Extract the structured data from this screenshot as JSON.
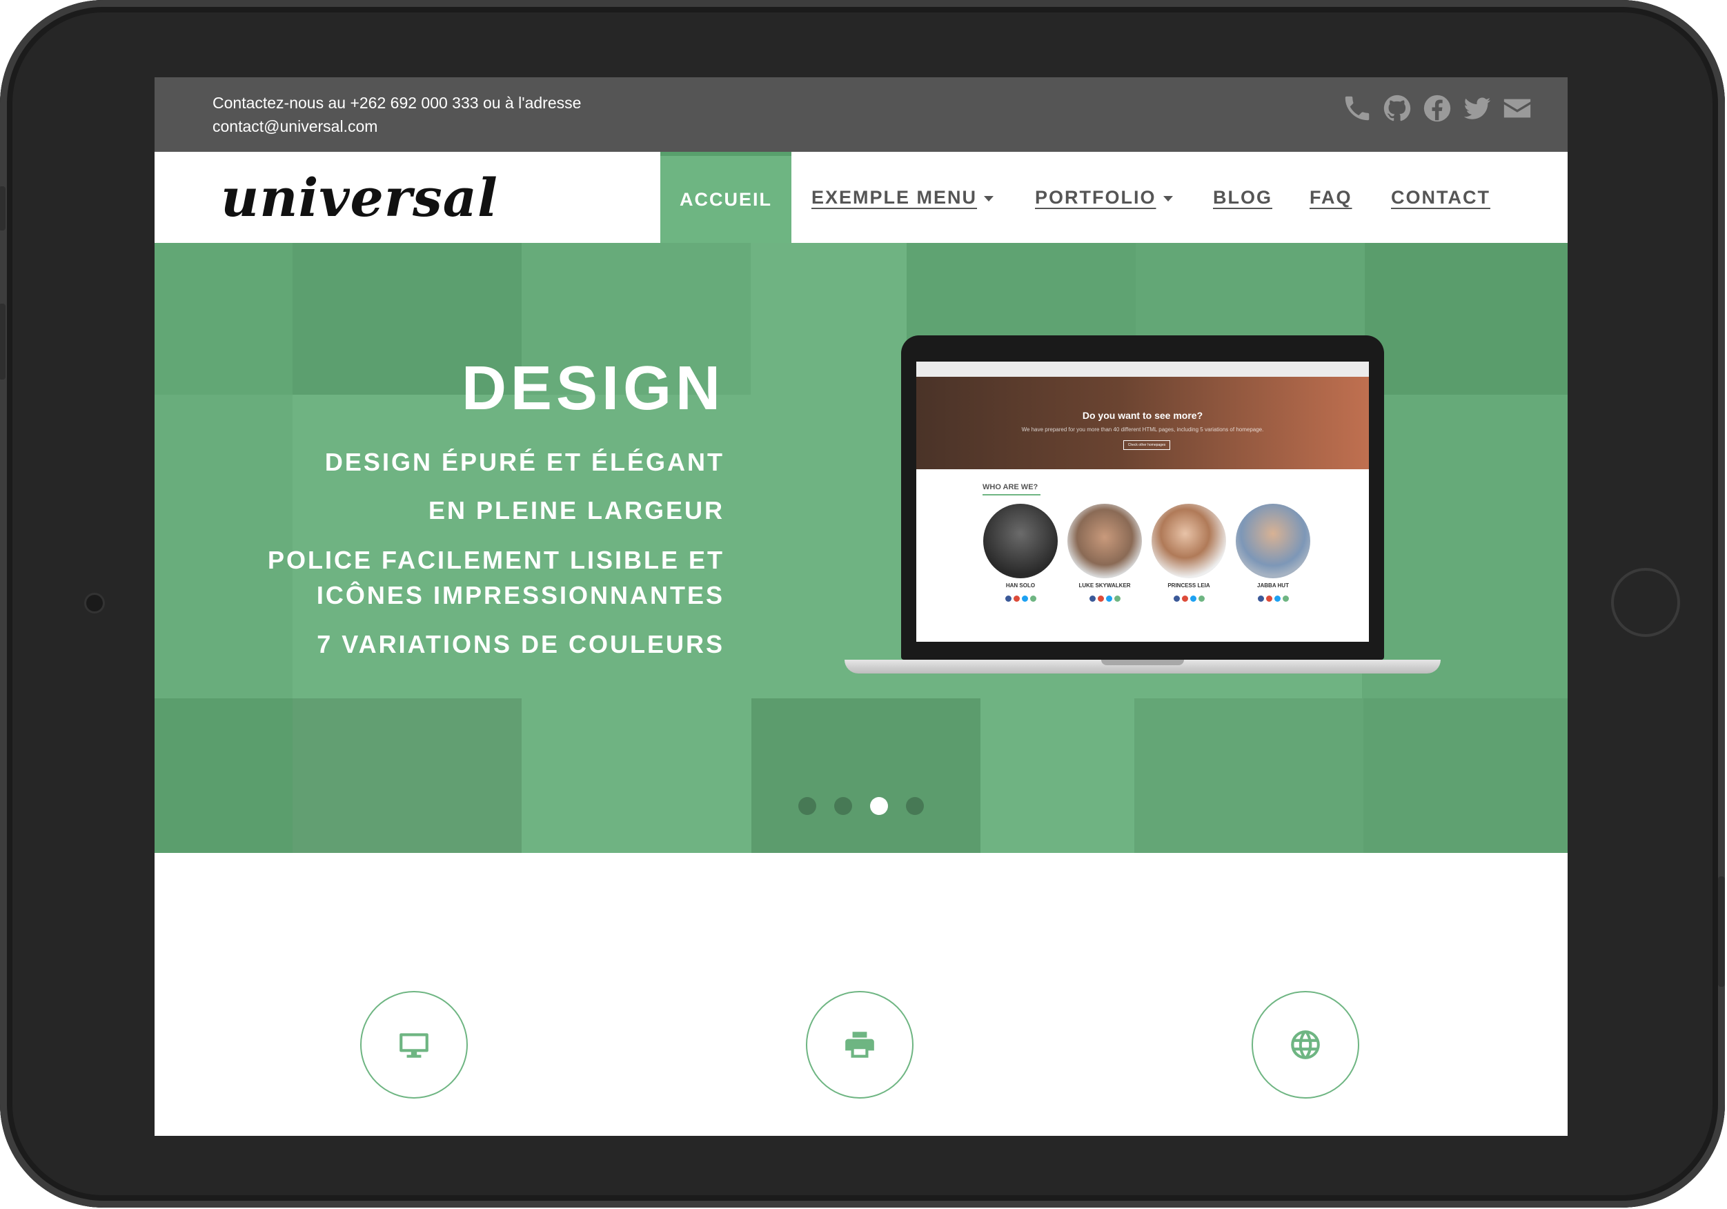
{
  "topbar": {
    "contact_line1": "Contactez-nous au +262 692 000 333 ou à l'adresse",
    "contact_line2": "contact@universal.com",
    "social_icons": [
      "phone-icon",
      "github-icon",
      "facebook-icon",
      "twitter-icon",
      "envelope-icon"
    ]
  },
  "navbar": {
    "logo": "universal",
    "items": [
      {
        "label": "ACCUEIL",
        "active": true
      },
      {
        "label": "EXEMPLE MENU",
        "dropdown": true
      },
      {
        "label": "PORTFOLIO",
        "dropdown": true
      },
      {
        "label": "BLOG"
      },
      {
        "label": "FAQ"
      },
      {
        "label": "CONTACT"
      }
    ]
  },
  "hero": {
    "title": "DESIGN",
    "lines": [
      "DESIGN ÉPURÉ ET ÉLÉGANT",
      "EN PLEINE LARGEUR",
      "POLICE FACILEMENT LISIBLE ET",
      "ICÔNES IMPRESSIONNANTES",
      "7 VARIATIONS DE COULEURS"
    ],
    "laptop_screen": {
      "hero_title": "Do you want to see more?",
      "hero_subtitle": "We have prepared for you more than 40 different HTML pages, including 5 variations of homepage.",
      "hero_button": "Check other homepages",
      "section_title": "WHO ARE WE?",
      "people": [
        {
          "name": "HAN SOLO"
        },
        {
          "name": "LUKE SKYWALKER"
        },
        {
          "name": "PRINCESS LEIA"
        },
        {
          "name": "JABBA HUT"
        }
      ]
    },
    "carousel": {
      "slides": 4,
      "active_index": 2
    }
  },
  "features": [
    {
      "icon": "desktop-icon"
    },
    {
      "icon": "print-icon"
    },
    {
      "icon": "globe-icon"
    }
  ],
  "colors": {
    "accent": "#6eb582",
    "topbar": "#555555",
    "hero_overlay": "#6fb382",
    "nav_text": "#555555"
  }
}
